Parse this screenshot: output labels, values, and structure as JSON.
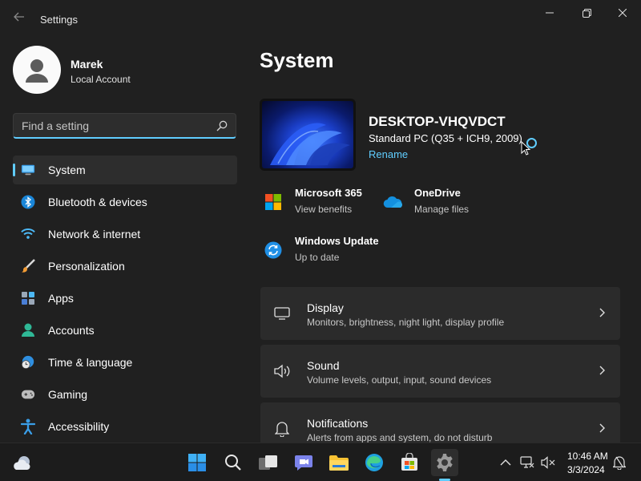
{
  "window": {
    "title": "Settings",
    "controls": [
      "minimize",
      "maximize",
      "close"
    ]
  },
  "user": {
    "name": "Marek",
    "account_type": "Local Account"
  },
  "search": {
    "placeholder": "Find a setting"
  },
  "nav": {
    "items": [
      {
        "label": "System",
        "icon": "monitor-icon",
        "active": true
      },
      {
        "label": "Bluetooth & devices",
        "icon": "bluetooth-icon"
      },
      {
        "label": "Network & internet",
        "icon": "wifi-icon"
      },
      {
        "label": "Personalization",
        "icon": "brush-icon"
      },
      {
        "label": "Apps",
        "icon": "apps-icon"
      },
      {
        "label": "Accounts",
        "icon": "person-icon"
      },
      {
        "label": "Time & language",
        "icon": "globe-clock-icon"
      },
      {
        "label": "Gaming",
        "icon": "gamepad-icon"
      },
      {
        "label": "Accessibility",
        "icon": "accessibility-icon"
      }
    ]
  },
  "page": {
    "title": "System"
  },
  "device": {
    "name": "DESKTOP-VHQVDCT",
    "model": "Standard PC (Q35 + ICH9, 2009)",
    "rename_label": "Rename"
  },
  "tiles": [
    {
      "title": "Microsoft 365",
      "subtitle": "View benefits",
      "icon": "microsoft-365-icon"
    },
    {
      "title": "OneDrive",
      "subtitle": "Manage files",
      "icon": "onedrive-icon"
    },
    {
      "title": "Windows Update",
      "subtitle": "Up to date",
      "icon": "windows-update-icon"
    }
  ],
  "cards": [
    {
      "title": "Display",
      "subtitle": "Monitors, brightness, night light, display profile",
      "icon": "display-icon"
    },
    {
      "title": "Sound",
      "subtitle": "Volume levels, output, input, sound devices",
      "icon": "speaker-icon"
    },
    {
      "title": "Notifications",
      "subtitle": "Alerts from apps and system, do not disturb",
      "icon": "bell-icon"
    }
  ],
  "taskbar": {
    "apps": [
      "weather-icon",
      "start-icon",
      "search-icon",
      "task-view-icon",
      "teams-chat-icon",
      "file-explorer-icon",
      "edge-icon",
      "store-icon",
      "settings-icon"
    ],
    "active_app": "settings-icon",
    "time": "10:46 AM",
    "date": "3/3/2024"
  },
  "colors": {
    "accent": "#60cdff",
    "background": "#202020",
    "card": "#2b2b2b"
  }
}
